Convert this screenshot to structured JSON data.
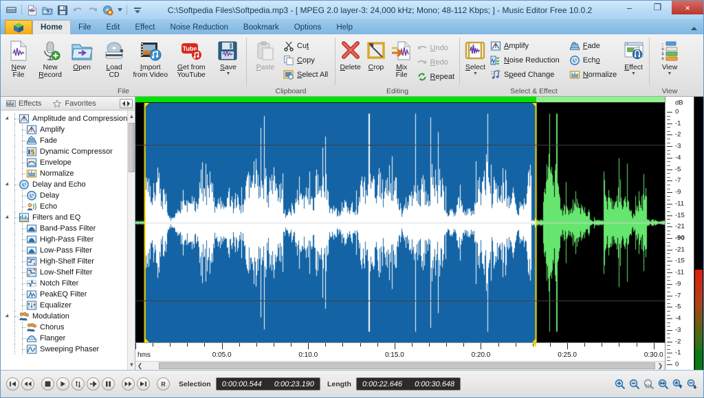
{
  "window": {
    "title": "C:\\Softpedia Files\\Softpedia.mp3 - [ MPEG 2.0 layer-3: 24,000 kHz; Mono; 48-112 Kbps;  ] - Music Editor Free 10.0.2",
    "minimize": "–",
    "maximize": "❐",
    "close": "×"
  },
  "quick_access": [
    {
      "name": "app-menu-icon",
      "label": ""
    },
    {
      "name": "new-file-icon",
      "label": ""
    },
    {
      "name": "open-icon",
      "label": ""
    },
    {
      "name": "save-icon",
      "label": ""
    },
    {
      "name": "undo-icon",
      "label": ""
    },
    {
      "name": "redo-icon",
      "label": ""
    },
    {
      "name": "burn-cd-icon",
      "label": ""
    },
    {
      "name": "quick-access-dropdown-icon",
      "label": ""
    },
    {
      "name": "customize-toolbar-icon",
      "label": ""
    }
  ],
  "menu": {
    "app_button": "app-logo",
    "tabs": [
      {
        "label": "Home",
        "active": true
      },
      {
        "label": "File",
        "active": false
      },
      {
        "label": "Edit",
        "active": false
      },
      {
        "label": "Effect",
        "active": false
      },
      {
        "label": "Noise Reduction",
        "active": false
      },
      {
        "label": "Bookmark",
        "active": false
      },
      {
        "label": "Options",
        "active": false
      },
      {
        "label": "Help",
        "active": false
      }
    ],
    "collapse_icon": "chevron-up-icon"
  },
  "ribbon": {
    "groups": [
      {
        "name": "File",
        "label": "File",
        "big_buttons": [
          {
            "label_line1": "New",
            "label_line2": "File",
            "icon": "new-file-icon",
            "accel": "N",
            "disabled": false
          },
          {
            "label_line1": "New",
            "label_line2": "Record",
            "icon": "new-record-icon",
            "accel": "R",
            "disabled": false
          },
          {
            "label_line1": "Open",
            "label_line2": "",
            "icon": "open-folder-icon",
            "accel": "O",
            "disabled": false
          },
          {
            "label_line1": "Load",
            "label_line2": "CD",
            "icon": "load-cd-icon",
            "accel": "L",
            "disabled": false
          },
          {
            "label_line1": "Import",
            "label_line2": "from Video",
            "icon": "import-video-icon",
            "accel": "I",
            "disabled": false
          },
          {
            "label_line1": "Get from",
            "label_line2": "YouTube",
            "icon": "youtube-icon",
            "accel": "G",
            "disabled": false
          },
          {
            "label_line1": "Save",
            "label_line2": "",
            "icon": "save-disk-icon",
            "accel": "S",
            "disabled": false,
            "has_dropdown": true
          }
        ]
      },
      {
        "name": "Clipboard",
        "label": "Clipboard",
        "big_buttons": [
          {
            "label_line1": "Paste",
            "label_line2": "",
            "icon": "paste-icon",
            "accel": "P",
            "disabled": true
          }
        ],
        "small_buttons": [
          {
            "label": "Cut",
            "icon": "cut-icon",
            "accel": "t",
            "disabled": false
          },
          {
            "label": "Copy",
            "icon": "copy-icon",
            "accel": "C",
            "disabled": false
          },
          {
            "label": "Select All",
            "icon": "select-all-icon",
            "accel": "S",
            "disabled": false
          }
        ]
      },
      {
        "name": "Editing",
        "label": "Editing",
        "big_buttons": [
          {
            "label_line1": "Delete",
            "label_line2": "",
            "icon": "delete-icon",
            "accel": "D",
            "disabled": false
          },
          {
            "label_line1": "Crop",
            "label_line2": "",
            "icon": "crop-icon",
            "accel": "C",
            "disabled": false
          },
          {
            "label_line1": "Mix",
            "label_line2": "File",
            "icon": "mix-file-icon",
            "accel": "M",
            "disabled": false
          }
        ],
        "small_buttons": [
          {
            "label": "Undo",
            "icon": "undo-icon",
            "accel": "U",
            "disabled": true
          },
          {
            "label": "Redo",
            "icon": "redo-icon",
            "accel": "R",
            "disabled": true
          },
          {
            "label": "Repeat",
            "icon": "repeat-icon",
            "accel": "R",
            "disabled": false
          }
        ]
      },
      {
        "name": "Select & Effect",
        "label": "Select & Effect",
        "big_buttons": [
          {
            "label_line1": "Select",
            "label_line2": "",
            "icon": "select-icon",
            "accel": "S",
            "disabled": false,
            "has_dropdown": true
          }
        ],
        "small_buttons": [
          {
            "label": "Amplify",
            "icon": "amplify-icon",
            "accel": "A",
            "disabled": false
          },
          {
            "label": "Noise Reduction",
            "icon": "noise-reduction-icon",
            "accel": "N",
            "disabled": false
          },
          {
            "label": "Speed Change",
            "icon": "speed-change-icon",
            "accel": "p",
            "disabled": false
          },
          {
            "label": "Fade",
            "icon": "fade-icon",
            "accel": "F",
            "disabled": false
          },
          {
            "label": "Echo",
            "icon": "echo-icon",
            "accel": "o",
            "disabled": false
          },
          {
            "label": "Normalize",
            "icon": "normalize-icon",
            "accel": "N",
            "disabled": false
          }
        ],
        "big_buttons_tail": [
          {
            "label_line1": "Effect",
            "label_line2": "",
            "icon": "effect-icon",
            "accel": "E",
            "disabled": false,
            "has_dropdown": true
          }
        ]
      },
      {
        "name": "View",
        "label": "View",
        "big_buttons": [
          {
            "label_line1": "View",
            "label_line2": "",
            "icon": "view-icon",
            "accel": "",
            "disabled": false,
            "has_dropdown": true
          }
        ]
      }
    ]
  },
  "sidebar": {
    "tabs": [
      {
        "label": "Effects",
        "icon": "effects-icon",
        "active": true
      },
      {
        "label": "Favorites",
        "icon": "favorites-star-icon",
        "active": false
      }
    ],
    "nav_icon": "panel-nav-icon",
    "tree": [
      {
        "label": "Amplitude and Compression",
        "level": 0,
        "icon": "amplitude-group-icon",
        "expanded": true
      },
      {
        "label": "Amplify",
        "level": 1,
        "icon": "amplify-icon"
      },
      {
        "label": "Fade",
        "level": 1,
        "icon": "fade-icon"
      },
      {
        "label": "Dynamic Compressor",
        "level": 1,
        "icon": "dynamic-compressor-icon"
      },
      {
        "label": "Envelope",
        "level": 1,
        "icon": "envelope-icon"
      },
      {
        "label": "Normalize",
        "level": 1,
        "icon": "normalize-icon"
      },
      {
        "label": "Delay and Echo",
        "level": 0,
        "icon": "delay-group-icon",
        "expanded": true
      },
      {
        "label": "Delay",
        "level": 1,
        "icon": "delay-icon"
      },
      {
        "label": "Echo",
        "level": 1,
        "icon": "echo-icon"
      },
      {
        "label": "Filters and EQ",
        "level": 0,
        "icon": "filters-group-icon",
        "expanded": true
      },
      {
        "label": "Band-Pass Filter",
        "level": 1,
        "icon": "band-pass-filter-icon"
      },
      {
        "label": "High-Pass Filter",
        "level": 1,
        "icon": "high-pass-filter-icon"
      },
      {
        "label": "Low-Pass Filter",
        "level": 1,
        "icon": "low-pass-filter-icon"
      },
      {
        "label": "High-Shelf Filter",
        "level": 1,
        "icon": "high-shelf-filter-icon"
      },
      {
        "label": "Low-Shelf Filter",
        "level": 1,
        "icon": "low-shelf-filter-icon"
      },
      {
        "label": "Notch Filter",
        "level": 1,
        "icon": "notch-filter-icon"
      },
      {
        "label": "PeakEQ Filter",
        "level": 1,
        "icon": "peakeq-filter-icon"
      },
      {
        "label": "Equalizer",
        "level": 1,
        "icon": "equalizer-icon"
      },
      {
        "label": "Modulation",
        "level": 0,
        "icon": "modulation-group-icon",
        "expanded": true
      },
      {
        "label": "Chorus",
        "level": 1,
        "icon": "chorus-icon"
      },
      {
        "label": "Flanger",
        "level": 1,
        "icon": "flanger-icon"
      },
      {
        "label": "Sweeping Phaser",
        "level": 1,
        "icon": "sweeping-phaser-icon"
      }
    ]
  },
  "timeline": {
    "unit_label": "hms",
    "labels": [
      "0:05.0",
      "0:10.0",
      "0:15.0",
      "0:20.0",
      "0:25.0",
      "0:30.0"
    ],
    "label_seconds": [
      5,
      10,
      15,
      20,
      25,
      30
    ],
    "total_seconds": 30.648,
    "major_interval": 5,
    "minor_interval": 1
  },
  "db_ruler": {
    "title": "dB",
    "labels": [
      "0",
      "-1",
      "-2",
      "-3",
      "-4",
      "-5",
      "-7",
      "-9",
      "-11",
      "-15",
      "-21",
      "-90",
      "-21",
      "-15",
      "-11",
      "-9",
      "-7",
      "-5",
      "-4",
      "-3",
      "-2",
      "-1",
      "0"
    ],
    "bold_label": "-90"
  },
  "waveform": {
    "selection_start_seconds": 0.544,
    "selection_end_seconds": 23.19,
    "selected_fill": "#1464a5",
    "selected_wave": "#ffffff",
    "unselected_fill": "#000000",
    "unselected_wave": "#66e66e",
    "marker_color": "#ffe000",
    "channel_bar_color": "#00e200"
  },
  "statusbar": {
    "transport": [
      {
        "name": "go-to-start-button",
        "glyph": "skip-start"
      },
      {
        "name": "rewind-button",
        "glyph": "rewind"
      },
      {
        "name": "stop-button",
        "glyph": "stop"
      },
      {
        "name": "play-button",
        "glyph": "play"
      },
      {
        "name": "loop-button",
        "glyph": "loop"
      },
      {
        "name": "play-selection-button",
        "glyph": "arrow-right"
      },
      {
        "name": "pause-button",
        "glyph": "pause"
      },
      {
        "name": "fast-forward-button",
        "glyph": "forward"
      },
      {
        "name": "go-to-end-button",
        "glyph": "skip-end"
      },
      {
        "name": "record-button",
        "glyph": "R"
      }
    ],
    "selection_label": "Selection",
    "selection_start": "0:00:00.544",
    "selection_end": "0:00:23.190",
    "length_label": "Length",
    "length_selected": "0:00:22.646",
    "length_total": "0:00:30.648",
    "zoom_buttons": [
      {
        "name": "zoom-in-button",
        "glyph": "zoom-in"
      },
      {
        "name": "zoom-out-button",
        "glyph": "zoom-out"
      },
      {
        "name": "zoom-selection-button",
        "glyph": "zoom-sel"
      },
      {
        "name": "zoom-full-button",
        "glyph": "zoom-full"
      },
      {
        "name": "zoom-vertical-in-button",
        "glyph": "zoom-vin"
      },
      {
        "name": "zoom-vertical-out-button",
        "glyph": "zoom-vout"
      }
    ]
  },
  "colors": {
    "accent": "#1464a5",
    "titlebar": "#bcdcf6",
    "close_button": "#b9362c",
    "app_button": "#f2a816",
    "wave_green": "#66e66e"
  }
}
